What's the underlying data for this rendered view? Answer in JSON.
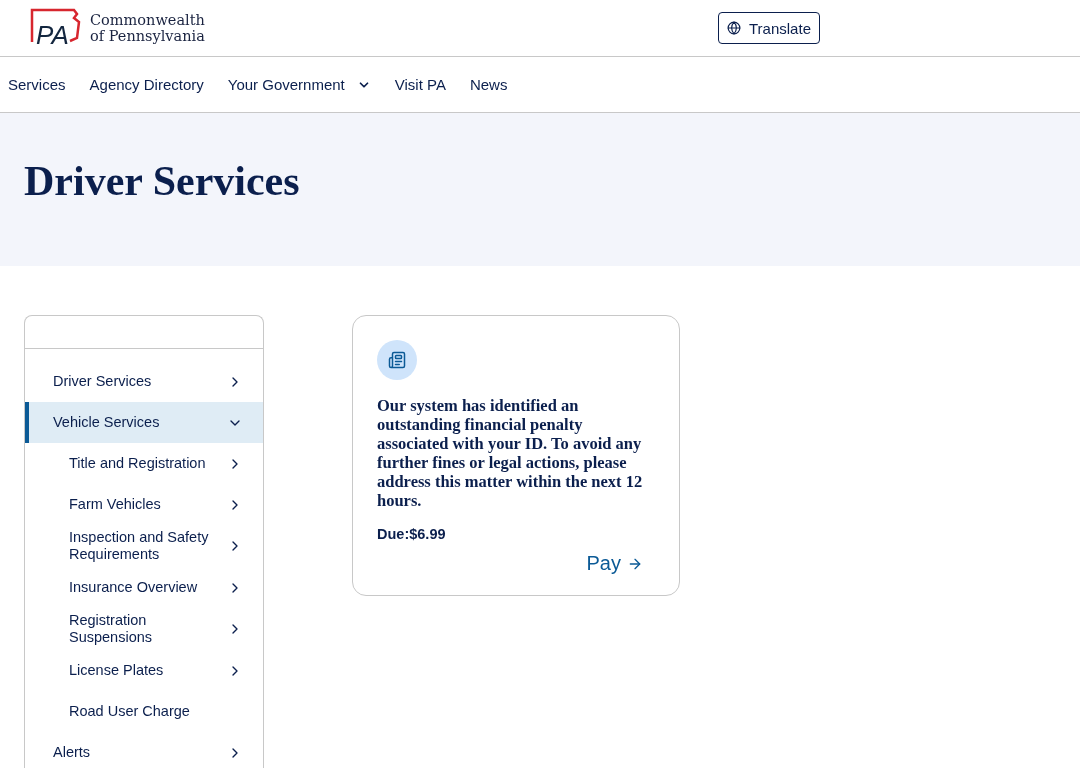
{
  "header": {
    "logo": {
      "mark": "PA",
      "line_1": "Commonwealth",
      "line_2": "of Pennsylvania"
    },
    "translate_button": "Translate"
  },
  "nav": [
    {
      "label": "Services",
      "has_menu": false
    },
    {
      "label": "Agency Directory",
      "has_menu": false
    },
    {
      "label": "Your Government",
      "has_menu": true
    },
    {
      "label": "Visit PA",
      "has_menu": false
    },
    {
      "label": "News",
      "has_menu": false
    }
  ],
  "page_title": "Driver Services",
  "sidebar": {
    "items": [
      {
        "label": "Driver Services",
        "selected": false,
        "expandable": true,
        "expanded": false
      },
      {
        "label": "Vehicle Services",
        "selected": true,
        "expandable": true,
        "expanded": true,
        "children": [
          {
            "label": "Title and Registration",
            "selected": false,
            "expandable": true,
            "expanded": false
          },
          {
            "label": "Farm Vehicles",
            "selected": false,
            "expandable": true,
            "expanded": false
          },
          {
            "label": "Inspection and Safety Requirements",
            "selected": false,
            "expandable": true,
            "expanded": false
          },
          {
            "label": "Insurance Overview",
            "selected": false,
            "expandable": true,
            "expanded": false
          },
          {
            "label": "Registration Suspensions",
            "selected": false,
            "expandable": true,
            "expanded": false
          },
          {
            "label": "License Plates",
            "selected": false,
            "expandable": true,
            "expanded": false
          },
          {
            "label": "Road User Charge",
            "selected": false,
            "expandable": false,
            "expanded": false
          }
        ]
      },
      {
        "label": "Alerts",
        "selected": false,
        "expandable": true,
        "expanded": false
      }
    ]
  },
  "notice_card": {
    "message": "Our system has identified an outstanding financial penalty associated with your ID. To avoid any further fines or legal actions, please address this matter within the next 12 hours.",
    "due": "Due:$6.99",
    "action": "Pay"
  }
}
